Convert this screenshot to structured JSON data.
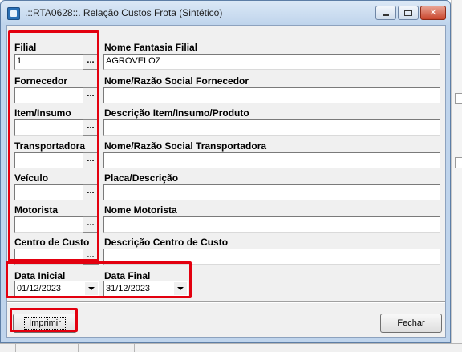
{
  "window": {
    "title": ".::RTA0628::. Relação Custos Frota (Sintético)",
    "close_glyph": "✕"
  },
  "colors": {
    "highlight": "#e3000f",
    "titlebar": "#bfd4ec",
    "close_button": "#c9452c"
  },
  "fields": [
    {
      "label": "Filial",
      "value": "1",
      "desc_label": "Nome Fantasia Filial",
      "desc_value": "AGROVELOZ"
    },
    {
      "label": "Fornecedor",
      "value": "",
      "desc_label": "Nome/Razão Social Fornecedor",
      "desc_value": ""
    },
    {
      "label": "Item/Insumo",
      "value": "",
      "desc_label": "Descrição Item/Insumo/Produto",
      "desc_value": ""
    },
    {
      "label": "Transportadora",
      "value": "",
      "desc_label": "Nome/Razão Social Transportadora",
      "desc_value": ""
    },
    {
      "label": "Veículo",
      "value": "",
      "desc_label": "Placa/Descrição",
      "desc_value": ""
    },
    {
      "label": "Motorista",
      "value": "",
      "desc_label": "Nome Motorista",
      "desc_value": ""
    },
    {
      "label": "Centro de Custo",
      "value": "",
      "desc_label": "Descrição Centro de Custo",
      "desc_value": ""
    }
  ],
  "lookup_glyph": "...",
  "dates": {
    "start_label": "Data Inicial",
    "start_value": "01/12/2023",
    "end_label": "Data Final",
    "end_value": "31/12/2023"
  },
  "buttons": {
    "print": "Imprimir",
    "close": "Fechar"
  }
}
